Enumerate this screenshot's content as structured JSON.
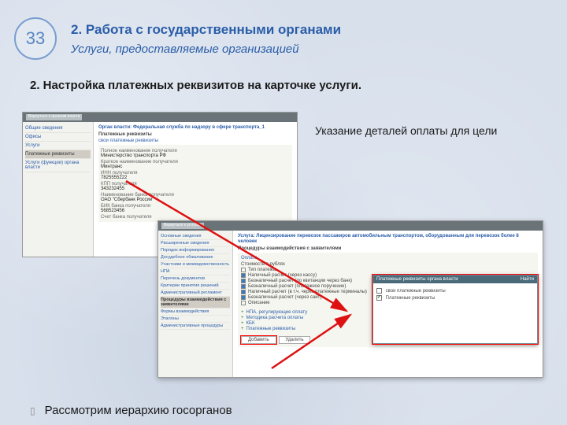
{
  "slide": {
    "number": "33",
    "title": "2. Работа с государственными органами",
    "subtitle": "Услуги, предоставляемые организацией",
    "section": "2. Настройка платежных реквизитов на карточке услуги.",
    "caption": "Указание деталей оплаты для цели",
    "footer": "Рассмотрим иерархию госорганов"
  },
  "shot1": {
    "back": "Вернуться к органам власти",
    "side": [
      "Общие сведения",
      "Офисы",
      "Услуги",
      "Платежные реквизиты",
      "Услуги (функции) органа власти"
    ],
    "side_sel": 3,
    "org": "Орган власти: Федеральная служба по надзору в сфере транспорта_1",
    "section": "Платежные реквизиты",
    "subsec": "свои платежные реквизиты",
    "fields": [
      {
        "label": "Полное наименование получателя",
        "value": "Министерство транспорта РФ"
      },
      {
        "label": "Краткое наименование получателя",
        "value": "Минтранс"
      },
      {
        "label": "ИНН получателя",
        "value": "7825555222"
      },
      {
        "label": "КПП получателя",
        "value": "343232455"
      },
      {
        "label": "Наименование банка получателя",
        "value": "ОАО \"Сбербанк России\""
      },
      {
        "label": "БИК банка получателя",
        "value": "568523456"
      },
      {
        "label": "Счет банка получателя",
        "value": ""
      }
    ]
  },
  "shot2": {
    "back": "Вернуться к услугам",
    "side": [
      "Основные сведения",
      "Расширенные сведения",
      "Порядок информирования",
      "Досудебное обжалование",
      "Участники и межведомственность",
      "НПА",
      "Перечень документов",
      "Критерии принятия решений",
      "Административный регламент",
      "Процедуры взаимодействия с заявителями",
      "Формы взаимодействия",
      "Эталоны",
      "Административные процедуры"
    ],
    "side_sel": 9,
    "org": "Услуга: Лицензирование перевозок пассажиров автомобильным транспортом, оборудованным для перевозок более 8 человек",
    "section": "Процедуры взаимодействия с заявителями",
    "subsec": "Оплата",
    "pay_label": "Стоимость в рублях",
    "checks": [
      {
        "label": "Тип платежа",
        "on": false
      },
      {
        "label": "Наличный расчет (через кассу)",
        "on": true
      },
      {
        "label": "Безналичный расчет (по квитанции через банк)",
        "on": true
      },
      {
        "label": "Безналичный расчет (платежное поручение)",
        "on": true
      },
      {
        "label": "Наличный расчет (в т.ч. через платежные терминалы)",
        "on": true
      },
      {
        "label": "Безналичный расчет (через сайт)",
        "on": true
      },
      {
        "label": "Описание",
        "on": false
      }
    ],
    "adds": [
      "НПА, регулирующие оплату",
      "Методика расчета оплаты",
      "КБК",
      "Платежные реквизиты"
    ],
    "buttons": {
      "add": "Добавить",
      "del": "Удалить"
    },
    "popup": {
      "title": "Платежные реквизиты органа власти",
      "search": "Найти",
      "items": [
        {
          "label": "свои платежные реквизиты",
          "on": false
        },
        {
          "label": "Платежные реквизиты",
          "on": true
        }
      ]
    }
  }
}
